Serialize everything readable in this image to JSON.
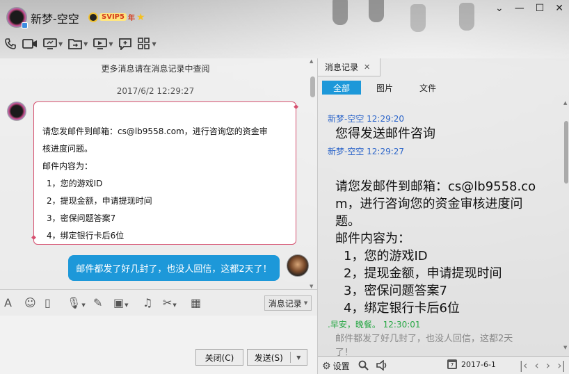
{
  "window": {
    "title": "新梦-空空",
    "vip_label": "SVIP5",
    "vip_year": "年"
  },
  "chat": {
    "more_messages": "更多消息请在消息记录中查阅",
    "timestamp": "2017/6/2 12:29:27",
    "incoming_message": {
      "line1": "请您发邮件到邮箱：cs@lb9558.com，进行咨询您的资金审",
      "line2": "核进度问题。",
      "line3": "邮件内容为：",
      "items": [
        "1，您的游戏ID",
        "2，提现金额，申请提现时间",
        "3，密保问题答案7",
        "4，绑定银行卡后6位"
      ]
    },
    "outgoing_message": "邮件都发了好几封了，也没人回信，这都2天了！"
  },
  "input_toolbar": {
    "history_button": "消息记录"
  },
  "input_area": {
    "close_button": "关闭(C)",
    "send_button": "发送(S)"
  },
  "history": {
    "tab_label": "消息记录",
    "filters": [
      "全部",
      "图片",
      "文件"
    ],
    "entries": [
      {
        "sender": "新梦-空空  12:29:20",
        "message": "您得发送邮件咨询"
      },
      {
        "sender": "新梦-空空  12:29:27"
      }
    ],
    "long_message": {
      "line1": "请您发邮件到邮箱：cs@lb9558.co",
      "line2": "m，进行咨询您的资金审核进度问",
      "line3": "题。",
      "line4": "邮件内容为：",
      "items": [
        "1，您的游戏ID",
        "2，提现金额，申请提现时间",
        "3，密保问题答案7",
        "4，绑定银行卡后6位"
      ]
    },
    "reply_sender": ".早安，晚餐。  12:30:01",
    "reply_message_line1": "邮件都发了好几封了，也没人回信，这都2天",
    "reply_message_line2": "了！",
    "settings_label": "设置",
    "date": "2017-6-1"
  },
  "colors": {
    "accent": "#1d98d9",
    "bubble_border": "#d6506f",
    "sender_blue": "#2b64c9",
    "sender_green": "#28a745"
  },
  "icons": [
    "phone-icon",
    "video-icon",
    "screen-share-icon",
    "file-transfer-icon",
    "remote-desktop-icon",
    "chat-add-icon",
    "apps-icon"
  ]
}
